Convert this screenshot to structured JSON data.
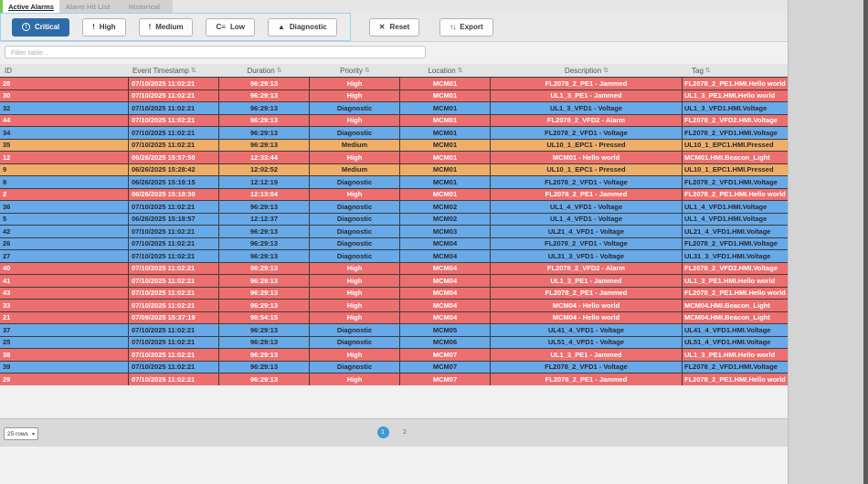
{
  "tabs": [
    {
      "label": "Active Alarms",
      "active": true
    },
    {
      "label": "Alarm Hit List",
      "active": false
    },
    {
      "label": "Historical",
      "active": false
    }
  ],
  "toolbar": {
    "filters": [
      {
        "label": "Critical",
        "icon": "alert-circle-icon",
        "active": true
      },
      {
        "label": "High",
        "icon": "exclamation-icon",
        "active": false
      },
      {
        "label": "Medium",
        "icon": "exclamation-icon",
        "active": false
      },
      {
        "label": "Low",
        "icon": "low-priority-icon",
        "active": false
      },
      {
        "label": "Diagnostic",
        "icon": "warning-triangle-icon",
        "active": false
      }
    ],
    "reset_label": "Reset",
    "export_label": "Export",
    "reset_icon": "✕",
    "export_icon": "↑↓",
    "low_icon_glyph": "C≡",
    "exclamation_glyph": "!",
    "triangle_glyph": "▲",
    "critical_glyph": "!"
  },
  "filter_input": {
    "placeholder": "Filter table..."
  },
  "table": {
    "columns": [
      {
        "label": "ID",
        "sortable": false
      },
      {
        "label": "Event Timestamp",
        "sortable": true
      },
      {
        "label": "Duration",
        "sortable": true
      },
      {
        "label": "Priority",
        "sortable": true
      },
      {
        "label": "Location",
        "sortable": true
      },
      {
        "label": "Description",
        "sortable": true
      },
      {
        "label": "Tag",
        "sortable": true
      }
    ],
    "sort_glyph": "⇅",
    "rows": [
      {
        "id": "28",
        "timestamp": "07/10/2025 11:02:21",
        "duration": "96:29:13",
        "priority": "High",
        "location": "MCM01",
        "description": "FL2078_2_PE1 - Jammed",
        "tag": "FL2078_2_PE1.HMI.Hello world",
        "sev": "high"
      },
      {
        "id": "30",
        "timestamp": "07/10/2025 11:02:21",
        "duration": "96:29:13",
        "priority": "High",
        "location": "MCM01",
        "description": "UL1_3_PE1 - Jammed",
        "tag": "UL1_3_PE1.HMI.Hello world",
        "sev": "high"
      },
      {
        "id": "32",
        "timestamp": "07/10/2025 11:02:21",
        "duration": "96:29:13",
        "priority": "Diagnostic",
        "location": "MCM01",
        "description": "UL1_3_VFD1 - Voltage",
        "tag": "UL1_3_VFD1.HMI.Voltage",
        "sev": "diagnostic"
      },
      {
        "id": "44",
        "timestamp": "07/10/2025 11:02:21",
        "duration": "96:29:13",
        "priority": "High",
        "location": "MCM01",
        "description": "FL2078_2_VFD2 - Alarm",
        "tag": "FL2078_2_VFD2.HMI.Voltage",
        "sev": "high"
      },
      {
        "id": "34",
        "timestamp": "07/10/2025 11:02:21",
        "duration": "96:29:13",
        "priority": "Diagnostic",
        "location": "MCM01",
        "description": "FL2078_2_VFD1 - Voltage",
        "tag": "FL2078_2_VFD1.HMI.Voltage",
        "sev": "diagnostic"
      },
      {
        "id": "35",
        "timestamp": "07/10/2025 11:02:21",
        "duration": "96:29:13",
        "priority": "Medium",
        "location": "MCM01",
        "description": "UL10_1_EPC1 - Pressed",
        "tag": "UL10_1_EPC1.HMI.Pressed",
        "sev": "medium"
      },
      {
        "id": "12",
        "timestamp": "06/26/2025 15:57:50",
        "duration": "12:33:44",
        "priority": "High",
        "location": "MCM01",
        "description": "MCM01 - Hello world",
        "tag": "MCM01.HMI.Beacon_Light",
        "sev": "high"
      },
      {
        "id": "9",
        "timestamp": "06/26/2025 15:28:42",
        "duration": "12:02:52",
        "priority": "Medium",
        "location": "MCM01",
        "description": "UL10_1_EPC1 - Pressed",
        "tag": "UL10_1_EPC1.HMI.Pressed",
        "sev": "medium"
      },
      {
        "id": "8",
        "timestamp": "06/26/2025 15:19:15",
        "duration": "12:12:19",
        "priority": "Diagnostic",
        "location": "MCM01",
        "description": "FL2078_2_VFD1 - Voltage",
        "tag": "FL2078_2_VFD1.HMI.Voltage",
        "sev": "diagnostic"
      },
      {
        "id": "2",
        "timestamp": "06/26/2025 15:18:30",
        "duration": "12:13:04",
        "priority": "High",
        "location": "MCM01",
        "description": "FL2078_2_PE1 - Jammed",
        "tag": "FL2078_2_PE1.HMI.Hello world",
        "sev": "high"
      },
      {
        "id": "36",
        "timestamp": "07/10/2025 11:02:21",
        "duration": "96:29:13",
        "priority": "Diagnostic",
        "location": "MCM02",
        "description": "UL1_4_VFD1 - Voltage",
        "tag": "UL1_4_VFD1.HMI.Voltage",
        "sev": "diagnostic"
      },
      {
        "id": "5",
        "timestamp": "06/26/2025 15:18:57",
        "duration": "12:12:37",
        "priority": "Diagnostic",
        "location": "MCM02",
        "description": "UL1_4_VFD1 - Voltage",
        "tag": "UL1_4_VFD1.HMI.Voltage",
        "sev": "diagnostic"
      },
      {
        "id": "42",
        "timestamp": "07/10/2025 11:02:21",
        "duration": "96:29:13",
        "priority": "Diagnostic",
        "location": "MCM03",
        "description": "UL21_4_VFD1 - Voltage",
        "tag": "UL21_4_VFD1.HMI.Voltage",
        "sev": "diagnostic"
      },
      {
        "id": "26",
        "timestamp": "07/10/2025 11:02:21",
        "duration": "96:29:13",
        "priority": "Diagnostic",
        "location": "MCM04",
        "description": "FL2078_2_VFD1 - Voltage",
        "tag": "FL2078_2_VFD1.HMI.Voltage",
        "sev": "diagnostic"
      },
      {
        "id": "27",
        "timestamp": "07/10/2025 11:02:21",
        "duration": "96:29:13",
        "priority": "Diagnostic",
        "location": "MCM04",
        "description": "UL31_3_VFD1 - Voltage",
        "tag": "UL31_3_VFD1.HMI.Voltage",
        "sev": "diagnostic"
      },
      {
        "id": "40",
        "timestamp": "07/10/2025 11:02:21",
        "duration": "96:29:13",
        "priority": "High",
        "location": "MCM04",
        "description": "FL2078_2_VFD2 - Alarm",
        "tag": "FL2078_2_VFD2.HMI.Voltage",
        "sev": "high"
      },
      {
        "id": "41",
        "timestamp": "07/10/2025 11:02:21",
        "duration": "96:29:13",
        "priority": "High",
        "location": "MCM04",
        "description": "UL1_3_PE1 - Jammed",
        "tag": "UL1_3_PE1.HMI.Hello world",
        "sev": "high"
      },
      {
        "id": "43",
        "timestamp": "07/10/2025 11:02:21",
        "duration": "96:29:13",
        "priority": "High",
        "location": "MCM04",
        "description": "FL2078_2_PE1 - Jammed",
        "tag": "FL2078_2_PE1.HMI.Hello world",
        "sev": "high"
      },
      {
        "id": "33",
        "timestamp": "07/10/2025 11:02:21",
        "duration": "96:29:13",
        "priority": "High",
        "location": "MCM04",
        "description": "MCM04 - Hello world",
        "tag": "MCM04.HMI.Beacon_Light",
        "sev": "high"
      },
      {
        "id": "21",
        "timestamp": "07/09/2025 15:37:19",
        "duration": "98:54:15",
        "priority": "High",
        "location": "MCM04",
        "description": "MCM04 - Hello world",
        "tag": "MCM04.HMI.Beacon_Light",
        "sev": "high"
      },
      {
        "id": "37",
        "timestamp": "07/10/2025 11:02:21",
        "duration": "96:29:13",
        "priority": "Diagnostic",
        "location": "MCM05",
        "description": "UL41_4_VFD1 - Voltage",
        "tag": "UL41_4_VFD1.HMI.Voltage",
        "sev": "diagnostic"
      },
      {
        "id": "25",
        "timestamp": "07/10/2025 11:02:21",
        "duration": "96:29:13",
        "priority": "Diagnostic",
        "location": "MCM06",
        "description": "UL51_4_VFD1 - Voltage",
        "tag": "UL51_4_VFD1.HMI.Voltage",
        "sev": "diagnostic"
      },
      {
        "id": "38",
        "timestamp": "07/10/2025 11:02:21",
        "duration": "96:29:13",
        "priority": "High",
        "location": "MCM07",
        "description": "UL1_3_PE1 - Jammed",
        "tag": "UL1_3_PE1.HMI.Hello world",
        "sev": "high"
      },
      {
        "id": "39",
        "timestamp": "07/10/2025 11:02:21",
        "duration": "96:29:13",
        "priority": "Diagnostic",
        "location": "MCM07",
        "description": "FL2078_2_VFD1 - Voltage",
        "tag": "FL2078_2_VFD1.HMI.Voltage",
        "sev": "diagnostic"
      },
      {
        "id": "29",
        "timestamp": "07/10/2025 11:02:21",
        "duration": "96:29:13",
        "priority": "High",
        "location": "MCM07",
        "description": "FL2078_2_PE1 - Jammed",
        "tag": "FL2078_2_PE1.HMI.Hello world",
        "sev": "high"
      }
    ]
  },
  "footer": {
    "rows_per_page": "25 rows",
    "pages": [
      "1",
      "2"
    ],
    "active_page": "1"
  },
  "colors": {
    "high_bg": "#ed6e6e",
    "medium_bg": "#efae68",
    "diagnostic_bg": "#68a9e8",
    "high_text": "#ffffff",
    "dark_text": "#26292e",
    "critical_button": "#2d6ca8",
    "filter_group_border": "#93d6ef",
    "pagination_active": "#3c9bd5",
    "tab_accent": "#7ac943"
  }
}
